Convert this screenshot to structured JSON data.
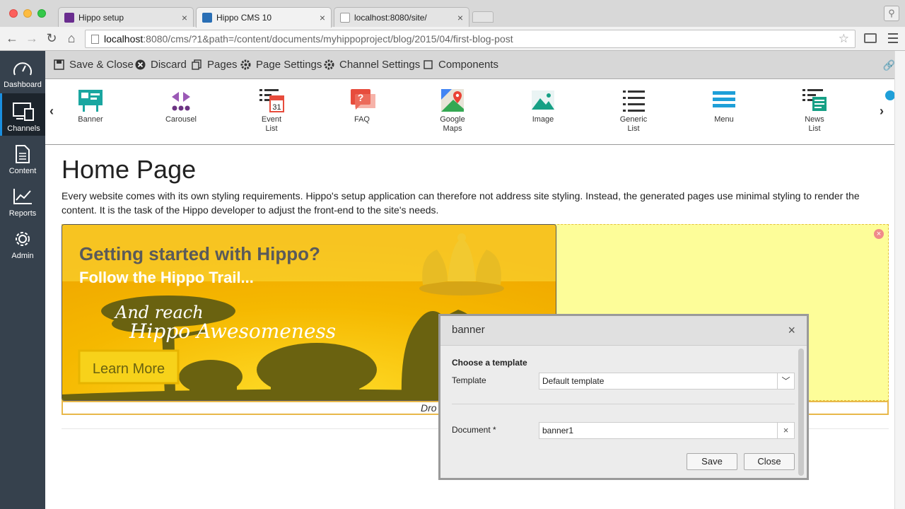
{
  "browser": {
    "tabs": [
      {
        "title": "Hippo setup",
        "favicon": "hippo-icon"
      },
      {
        "title": "Hippo CMS 10",
        "favicon": "hippo-icon"
      },
      {
        "title": "localhost:8080/site/",
        "favicon": "page-icon"
      }
    ],
    "active_tab": 1,
    "url_host": "localhost",
    "url_rest": ":8080/cms/?1&path=/content/documents/myhippoproject/blog/2015/04/first-blog-post"
  },
  "sidebar": {
    "items": [
      {
        "label": "Dashboard",
        "icon": "gauge-icon"
      },
      {
        "label": "Channels",
        "icon": "devices-icon"
      },
      {
        "label": "Content",
        "icon": "document-icon"
      },
      {
        "label": "Reports",
        "icon": "chart-icon"
      },
      {
        "label": "Admin",
        "icon": "gear-icon"
      }
    ],
    "active_index": 1,
    "accent": "#1a8fe0"
  },
  "cms_toolbar": {
    "save_close": "Save & Close",
    "discard": "Discard",
    "pages": "Pages",
    "page_settings": "Page Settings",
    "channel_settings": "Channel Settings",
    "components": "Components"
  },
  "components": [
    {
      "label": "Banner",
      "icon": "banner-icon"
    },
    {
      "label": "Carousel",
      "icon": "carousel-icon"
    },
    {
      "label": "Event\nList",
      "icon": "calendar-icon"
    },
    {
      "label": "FAQ",
      "icon": "faq-icon"
    },
    {
      "label": "Google\nMaps",
      "icon": "map-icon"
    },
    {
      "label": "Image",
      "icon": "image-icon"
    },
    {
      "label": "Generic\nList",
      "icon": "list-icon"
    },
    {
      "label": "Menu",
      "icon": "menu-icon"
    },
    {
      "label": "News\nList",
      "icon": "news-icon"
    }
  ],
  "page": {
    "title": "Home Page",
    "intro": "Every website comes with its own styling requirements. Hippo's setup application can therefore not address site styling. Instead, the generated pages use minimal styling to render the content. It is the task of the Hippo developer to adjust the front-end to the site's needs.",
    "dropzone_text": "Dro",
    "banner": {
      "headline": "Getting started with Hippo?",
      "subline": "Follow the Hippo Trail...",
      "script1": "And reach",
      "script2": "Hippo Awesomeness",
      "button": "Learn More"
    }
  },
  "dialog": {
    "title": "banner",
    "section": "Choose a template",
    "template_label": "Template",
    "template_value": "Default template",
    "document_label": "Document *",
    "document_value": "banner1",
    "save": "Save",
    "close": "Close"
  }
}
